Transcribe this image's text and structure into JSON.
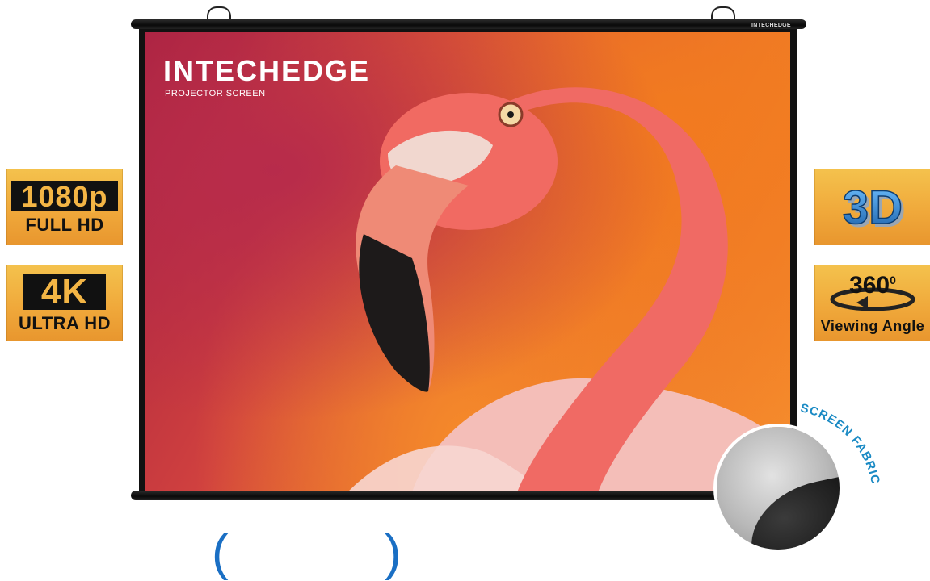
{
  "brand": {
    "name": "INTECHEDGE",
    "tagline": "PROJECTOR SCREEN",
    "rod_label": "INTECHEDGE"
  },
  "badges_left": [
    {
      "main": "1080p",
      "sub": "FULL HD"
    },
    {
      "main": "4K",
      "sub": "ULTRA HD"
    }
  ],
  "badges_right": [
    {
      "main": "3D"
    },
    {
      "main": "360",
      "sup": "0",
      "sub": "Viewing Angle"
    }
  ],
  "fabric": {
    "label": "SCREEN FABRIC"
  },
  "colors": {
    "badge_gold": "#f0a93b",
    "fabric_label_blue": "#1a8ac4",
    "bottom_bracket_blue": "#1a6fc4"
  }
}
